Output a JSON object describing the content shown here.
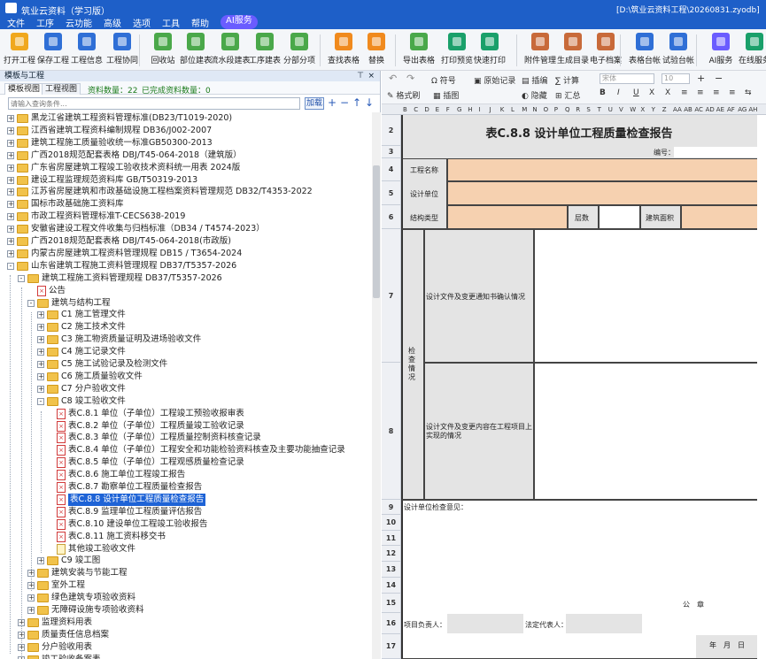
{
  "app": {
    "title": "筑业云资料（学习版）",
    "path": "[D:\\筑业云资料工程\\20260831.zyodb]"
  },
  "menu": [
    "文件",
    "工序",
    "云功能",
    "高级",
    "选项",
    "工具",
    "帮助"
  ],
  "ai_badge": "AI服务",
  "ribbon": [
    {
      "label": "打开工程",
      "icon": "folder-open-icon",
      "color": "#f0a81e"
    },
    {
      "label": "保存工程",
      "icon": "save-icon",
      "color": "#2f6fd6"
    },
    {
      "label": "工程信息",
      "icon": "building-icon",
      "color": "#2f6fd6"
    },
    {
      "label": "工程协同",
      "icon": "sync-icon",
      "color": "#2f6fd6"
    },
    {
      "label": "回收站",
      "icon": "recycle-bin-icon",
      "color": "#4aa84a"
    },
    {
      "label": "部位建表",
      "icon": "table-add-icon",
      "color": "#4aa84a"
    },
    {
      "label": "流水段建表",
      "icon": "list-table-icon",
      "color": "#4aa84a"
    },
    {
      "label": "工序建表",
      "icon": "grid-table-icon",
      "color": "#4aa84a"
    },
    {
      "label": "分部分项",
      "icon": "chart-icon",
      "color": "#4aa84a"
    },
    {
      "label": "查找表格",
      "icon": "search-icon",
      "color": "#f08a1e"
    },
    {
      "label": "替换",
      "icon": "replace-icon",
      "color": "#f08a1e"
    },
    {
      "label": "导出表格",
      "icon": "export-icon",
      "color": "#4aa84a"
    },
    {
      "label": "打印预览",
      "icon": "eye-icon",
      "color": "#1aa06a"
    },
    {
      "label": "快速打印",
      "icon": "printer-icon",
      "color": "#1aa06a"
    },
    {
      "label": "附件管理",
      "icon": "attachment-icon",
      "color": "#c86a3a"
    },
    {
      "label": "生成目录",
      "icon": "catalog-icon",
      "color": "#c86a3a"
    },
    {
      "label": "电子档案",
      "icon": "archive-icon",
      "color": "#c86a3a"
    },
    {
      "label": "表格台帐",
      "icon": "ledger-icon",
      "color": "#2f6fd6"
    },
    {
      "label": "试验台帐",
      "icon": "test-ledger-icon",
      "color": "#2f6fd6"
    },
    {
      "label": "AI服务",
      "icon": "ai-icon",
      "color": "#6a5cff"
    },
    {
      "label": "在线服务",
      "icon": "online-icon",
      "color": "#1aa06a"
    }
  ],
  "left_panel": {
    "title": "模板与工程",
    "tabs": [
      "模板视图",
      "工程视图"
    ],
    "data_count": "资料数量：22",
    "done_count": "已完成资料数量：0",
    "search_placeholder": "请输入查询条件...",
    "add_label": "加载"
  },
  "tree": [
    {
      "level": 0,
      "type": "folder",
      "exp": "+",
      "text": "黑龙江省建筑工程资料管理标准(DB23/T1019-2020)"
    },
    {
      "level": 0,
      "type": "folder",
      "exp": "+",
      "text": "江西省建筑工程资料编制规程 DB36/J002-2007"
    },
    {
      "level": 0,
      "type": "folder",
      "exp": "+",
      "text": "建筑工程施工质量验收统一标准GB50300-2013"
    },
    {
      "level": 0,
      "type": "folder",
      "exp": "+",
      "text": "广西2018规范配套表格 DBJ/T45-064-2018（建筑版）"
    },
    {
      "level": 0,
      "type": "folder",
      "exp": "+",
      "text": "广东省房屋建筑工程竣工验收技术资料统一用表 2024版"
    },
    {
      "level": 0,
      "type": "folder",
      "exp": "+",
      "text": "建设工程监理规范资料库 GB/T50319-2013"
    },
    {
      "level": 0,
      "type": "folder",
      "exp": "+",
      "text": "江苏省房屋建筑和市政基础设施工程档案资料管理规范 DB32/T4353-2022"
    },
    {
      "level": 0,
      "type": "folder",
      "exp": "+",
      "text": "国标市政基础施工资料库"
    },
    {
      "level": 0,
      "type": "folder",
      "exp": "+",
      "text": "市政工程资料管理标准T-CECS638-2019"
    },
    {
      "level": 0,
      "type": "folder",
      "exp": "+",
      "text": "安徽省建设工程文件收集与归档标准（DB34 / T4574-2023）"
    },
    {
      "level": 0,
      "type": "folder",
      "exp": "+",
      "text": "广西2018规范配套表格 DBJ/T45-064-2018(市政版)"
    },
    {
      "level": 0,
      "type": "folder",
      "exp": "+",
      "text": "内蒙古房屋建筑工程资料管理规程 DB15 / T3654-2024"
    },
    {
      "level": 0,
      "type": "folder",
      "exp": "-",
      "text": "山东省建筑工程施工资料管理规程 DB37/T5357-2026"
    },
    {
      "level": 1,
      "type": "folder",
      "exp": "-",
      "text": "建筑工程施工资料管理规程 DB37/T5357-2026"
    },
    {
      "level": 2,
      "type": "pdf",
      "exp": "",
      "text": "公告"
    },
    {
      "level": 2,
      "type": "folder",
      "exp": "-",
      "text": "建筑与结构工程"
    },
    {
      "level": 3,
      "type": "folder",
      "exp": "+",
      "text": "C1 施工管理文件"
    },
    {
      "level": 3,
      "type": "folder",
      "exp": "+",
      "text": "C2 施工技术文件"
    },
    {
      "level": 3,
      "type": "folder",
      "exp": "+",
      "text": "C3 施工物资质量证明及进场验收文件"
    },
    {
      "level": 3,
      "type": "folder",
      "exp": "+",
      "text": "C4 施工记录文件"
    },
    {
      "level": 3,
      "type": "folder",
      "exp": "+",
      "text": "C5 施工试验记录及检测文件"
    },
    {
      "level": 3,
      "type": "folder",
      "exp": "+",
      "text": "C6 施工质量验收文件"
    },
    {
      "level": 3,
      "type": "folder",
      "exp": "+",
      "text": "C7 分户验收文件"
    },
    {
      "level": 3,
      "type": "folder",
      "exp": "-",
      "text": "C8 竣工验收文件"
    },
    {
      "level": 4,
      "type": "pdf",
      "exp": "",
      "text": "表C.8.1 单位（子单位）工程竣工预验收报审表"
    },
    {
      "level": 4,
      "type": "pdf",
      "exp": "",
      "text": "表C.8.2 单位（子单位）工程质量竣工验收记录"
    },
    {
      "level": 4,
      "type": "pdf",
      "exp": "",
      "text": "表C.8.3 单位（子单位）工程质量控制资料核查记录"
    },
    {
      "level": 4,
      "type": "pdf",
      "exp": "",
      "text": "表C.8.4 单位（子单位）工程安全和功能检验资料核查及主要功能抽查记录"
    },
    {
      "level": 4,
      "type": "pdf",
      "exp": "",
      "text": "表C.8.5 单位（子单位）工程观感质量检查记录"
    },
    {
      "level": 4,
      "type": "pdf",
      "exp": "",
      "text": "表C.8.6 施工单位工程竣工报告"
    },
    {
      "level": 4,
      "type": "pdf",
      "exp": "",
      "text": "表C.8.7 勘察单位工程质量检查报告"
    },
    {
      "level": 4,
      "type": "pdf",
      "exp": "",
      "text": "表C.8.8 设计单位工程质量检查报告",
      "selected": true
    },
    {
      "level": 4,
      "type": "pdf",
      "exp": "",
      "text": "表C.8.9 监理单位工程质量评估报告"
    },
    {
      "level": 4,
      "type": "pdf",
      "exp": "",
      "text": "表C.8.10 建设单位工程竣工验收报告"
    },
    {
      "level": 4,
      "type": "pdf",
      "exp": "",
      "text": "表C.8.11 施工资料移交书"
    },
    {
      "level": 4,
      "type": "doc",
      "exp": "",
      "text": "其他竣工验收文件"
    },
    {
      "level": 3,
      "type": "folder",
      "exp": "+",
      "text": "C9 竣工图"
    },
    {
      "level": 2,
      "type": "folder",
      "exp": "+",
      "text": "建筑安装与节能工程"
    },
    {
      "level": 2,
      "type": "folder",
      "exp": "+",
      "text": "室外工程"
    },
    {
      "level": 2,
      "type": "folder",
      "exp": "+",
      "text": "绿色建筑专项验收资料"
    },
    {
      "level": 2,
      "type": "folder",
      "exp": "+",
      "text": "无障碍设施专项验收资料"
    },
    {
      "level": 1,
      "type": "folder",
      "exp": "+",
      "text": "监理资料用表"
    },
    {
      "level": 1,
      "type": "folder",
      "exp": "+",
      "text": "质量责任信息档案"
    },
    {
      "level": 1,
      "type": "folder",
      "exp": "+",
      "text": "分户验收用表"
    },
    {
      "level": 1,
      "type": "folder",
      "exp": "+",
      "text": "竣工验收备案表"
    }
  ],
  "right_toolbar": {
    "undo": "↶",
    "redo": "↷",
    "symbol": "符号",
    "raw_record": "原始记录",
    "insert": "插编",
    "calc": "计算",
    "format_brush": "格式刷",
    "illustration": "插图",
    "hide": "隐藏",
    "summary": "汇总",
    "font": "宋体",
    "size": "10",
    "bold": "B",
    "italic": "I",
    "underline": "U",
    "sub": "X",
    "sup": "X"
  },
  "columns": [
    "B",
    "C",
    "D",
    "E",
    "F",
    "G",
    "H",
    "I",
    "J",
    "K",
    "L",
    "M",
    "N",
    "O",
    "P",
    "Q",
    "R",
    "S",
    "T",
    "U",
    "V",
    "W",
    "X",
    "Y",
    "Z",
    "AA",
    "AB",
    "AC",
    "AD",
    "AE",
    "AF",
    "AG",
    "AH"
  ],
  "form": {
    "title": "表C.8.8 设计单位工程质量检查报告",
    "number_label": "编号：",
    "project_name": "工程名称",
    "design_unit": "设计单位",
    "structure_type": "结构类型",
    "floors": "层数",
    "area": "建筑面积",
    "inspection": "检查情况",
    "item1": "设计文件及变更通知书确认情况",
    "item2": "设计文件及变更内容在工程项目上实现的情况",
    "opinion": "设计单位检查意见：",
    "seal": "公　章",
    "leader": "项目负责人：",
    "legal_rep": "法定代表人：",
    "date": "年　月　日"
  },
  "rows": [
    "2",
    "3",
    "4",
    "5",
    "6",
    "7",
    "8",
    "9",
    "10",
    "11",
    "12",
    "13",
    "14",
    "15",
    "16",
    "17"
  ]
}
